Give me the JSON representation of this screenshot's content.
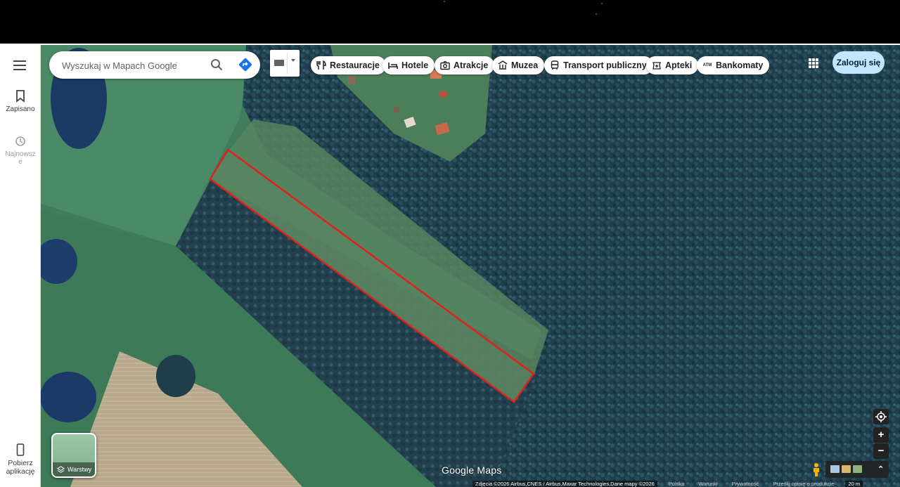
{
  "rail": {
    "menu_icon": "hamburger-icon",
    "saved_label": "Zapisano",
    "recent_label": "Najnowsz\ne",
    "download_label": "Pobierz\naplikację"
  },
  "search": {
    "placeholder": "Wyszukaj w Mapach Google",
    "search_icon": "search-icon",
    "directions_icon": "directions-icon"
  },
  "chips": [
    {
      "label": "Restauracje",
      "icon": "fork-knife-icon"
    },
    {
      "label": "Hotele",
      "icon": "bed-icon"
    },
    {
      "label": "Atrakcje",
      "icon": "camera-icon"
    },
    {
      "label": "Muzea",
      "icon": "museum-icon"
    },
    {
      "label": "Transport publiczny",
      "icon": "bus-icon"
    },
    {
      "label": "Apteki",
      "icon": "pharmacy-icon"
    },
    {
      "label": "Bankomaty",
      "icon": "atm-icon"
    }
  ],
  "header": {
    "signin_label": "Zaloguj się",
    "apps_icon": "apps-grid-icon"
  },
  "layers": {
    "label": "Warstwy",
    "icon": "layers-icon"
  },
  "map": {
    "logo": "Google Maps",
    "attribution": "Zdjęcia ©2026 Airbus,CNES / Airbus,Maxar Technologies,Dane mapy ©2026",
    "links": [
      "Polska",
      "Warunki",
      "Prywatność",
      "Prześlij opinię o produkcie"
    ],
    "scale": "20 m",
    "zoom_in": "+",
    "zoom_out": "−",
    "outline_color": "#e0211b"
  }
}
